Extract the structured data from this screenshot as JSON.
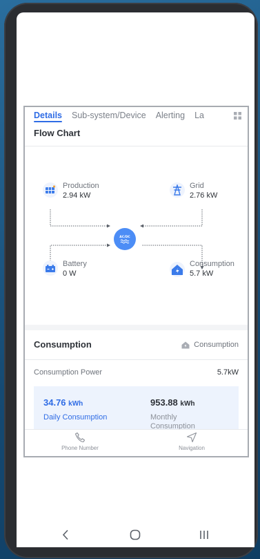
{
  "tabs": [
    {
      "label": "Details"
    },
    {
      "label": "Sub-system/Device"
    },
    {
      "label": "Alerting"
    },
    {
      "label": "La"
    }
  ],
  "flow_chart": {
    "title": "Flow Chart",
    "hub_label": "AC/DC",
    "production": {
      "label": "Production",
      "value": "2.94 kW"
    },
    "grid": {
      "label": "Grid",
      "value": "2.76 kW"
    },
    "battery": {
      "label": "Battery",
      "value": "0 W"
    },
    "consumption": {
      "label": "Consumption",
      "value": "5.7 kW"
    }
  },
  "consumption_section": {
    "title": "Consumption",
    "tag_label": "Consumption",
    "power_label": "Consumption Power",
    "power_value": "5.7kW",
    "daily_value": "34.76",
    "daily_unit": "kWh",
    "daily_label": "Daily Consumption",
    "monthly_value": "953.88",
    "monthly_unit": "kWh",
    "monthly_label_line1": "Monthly",
    "monthly_label_line2": "Consumption"
  },
  "bottom_nav": {
    "phone_label": "Phone Number",
    "navigation_label": "Navigation"
  },
  "colors": {
    "accent": "#2f6ce5",
    "hub": "#4c8df6",
    "daily_text": "#2f6ce5",
    "monthly_text": "#2e3238"
  }
}
